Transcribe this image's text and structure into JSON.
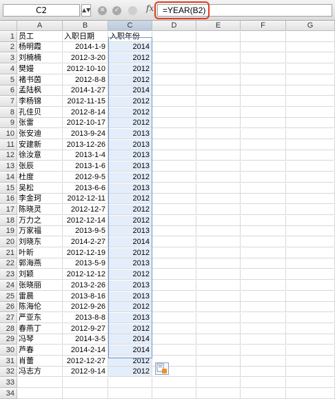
{
  "formula_bar": {
    "cell_ref": "C2",
    "fx_label": "fx",
    "formula": "=YEAR(B2)"
  },
  "columns": [
    "A",
    "B",
    "C",
    "D",
    "E",
    "F",
    "G"
  ],
  "rows": [
    {
      "n": "1",
      "a": "员工",
      "b": "入职日期",
      "c": "入职年份"
    },
    {
      "n": "2",
      "a": "杨明霞",
      "b": "2014-1-9",
      "c": "2014"
    },
    {
      "n": "3",
      "a": "刘楠楠",
      "b": "2012-3-20",
      "c": "2012"
    },
    {
      "n": "4",
      "a": "樊嫚",
      "b": "2012-10-10",
      "c": "2012"
    },
    {
      "n": "5",
      "a": "褚书茵",
      "b": "2012-8-8",
      "c": "2012"
    },
    {
      "n": "6",
      "a": "孟陆枫",
      "b": "2014-1-27",
      "c": "2014"
    },
    {
      "n": "7",
      "a": "李杨锦",
      "b": "2012-11-15",
      "c": "2012"
    },
    {
      "n": "8",
      "a": "孔佳贝",
      "b": "2012-8-14",
      "c": "2012"
    },
    {
      "n": "9",
      "a": "张雷",
      "b": "2012-10-17",
      "c": "2012"
    },
    {
      "n": "10",
      "a": "张安迪",
      "b": "2013-9-24",
      "c": "2013"
    },
    {
      "n": "11",
      "a": "安建新",
      "b": "2013-12-26",
      "c": "2013"
    },
    {
      "n": "12",
      "a": "徐汝意",
      "b": "2013-1-4",
      "c": "2013"
    },
    {
      "n": "13",
      "a": "张辰",
      "b": "2013-1-6",
      "c": "2013"
    },
    {
      "n": "14",
      "a": "杜度",
      "b": "2012-9-5",
      "c": "2012"
    },
    {
      "n": "15",
      "a": "吴松",
      "b": "2013-6-6",
      "c": "2013"
    },
    {
      "n": "16",
      "a": "李金珂",
      "b": "2012-12-11",
      "c": "2012"
    },
    {
      "n": "17",
      "a": "陈晓灵",
      "b": "2012-12-7",
      "c": "2012"
    },
    {
      "n": "18",
      "a": "万力之",
      "b": "2012-12-14",
      "c": "2012"
    },
    {
      "n": "19",
      "a": "万家福",
      "b": "2013-9-5",
      "c": "2013"
    },
    {
      "n": "20",
      "a": "刘晓东",
      "b": "2014-2-27",
      "c": "2014"
    },
    {
      "n": "21",
      "a": "叶昕",
      "b": "2012-12-19",
      "c": "2012"
    },
    {
      "n": "22",
      "a": "郭海燕",
      "b": "2013-5-9",
      "c": "2013"
    },
    {
      "n": "23",
      "a": "刘颖",
      "b": "2012-12-12",
      "c": "2012"
    },
    {
      "n": "24",
      "a": "张晓丽",
      "b": "2013-2-26",
      "c": "2013"
    },
    {
      "n": "25",
      "a": "雷晨",
      "b": "2013-8-16",
      "c": "2013"
    },
    {
      "n": "26",
      "a": "陈海伦",
      "b": "2012-9-26",
      "c": "2012"
    },
    {
      "n": "27",
      "a": "严亚东",
      "b": "2013-8-8",
      "c": "2013"
    },
    {
      "n": "28",
      "a": "春燕丁",
      "b": "2012-9-27",
      "c": "2012"
    },
    {
      "n": "29",
      "a": "冯琴",
      "b": "2014-3-5",
      "c": "2014"
    },
    {
      "n": "30",
      "a": "芦春",
      "b": "2014-2-14",
      "c": "2014"
    },
    {
      "n": "31",
      "a": "肖蕾",
      "b": "2012-12-27",
      "c": "2012"
    },
    {
      "n": "32",
      "a": "冯志方",
      "b": "2012-9-14",
      "c": "2012"
    },
    {
      "n": "33",
      "a": "",
      "b": "",
      "c": ""
    },
    {
      "n": "34",
      "a": "",
      "b": "",
      "c": ""
    }
  ],
  "selected_column": "C",
  "colors": {
    "highlight": "#e03a1e",
    "selection": "#6e96d0"
  }
}
